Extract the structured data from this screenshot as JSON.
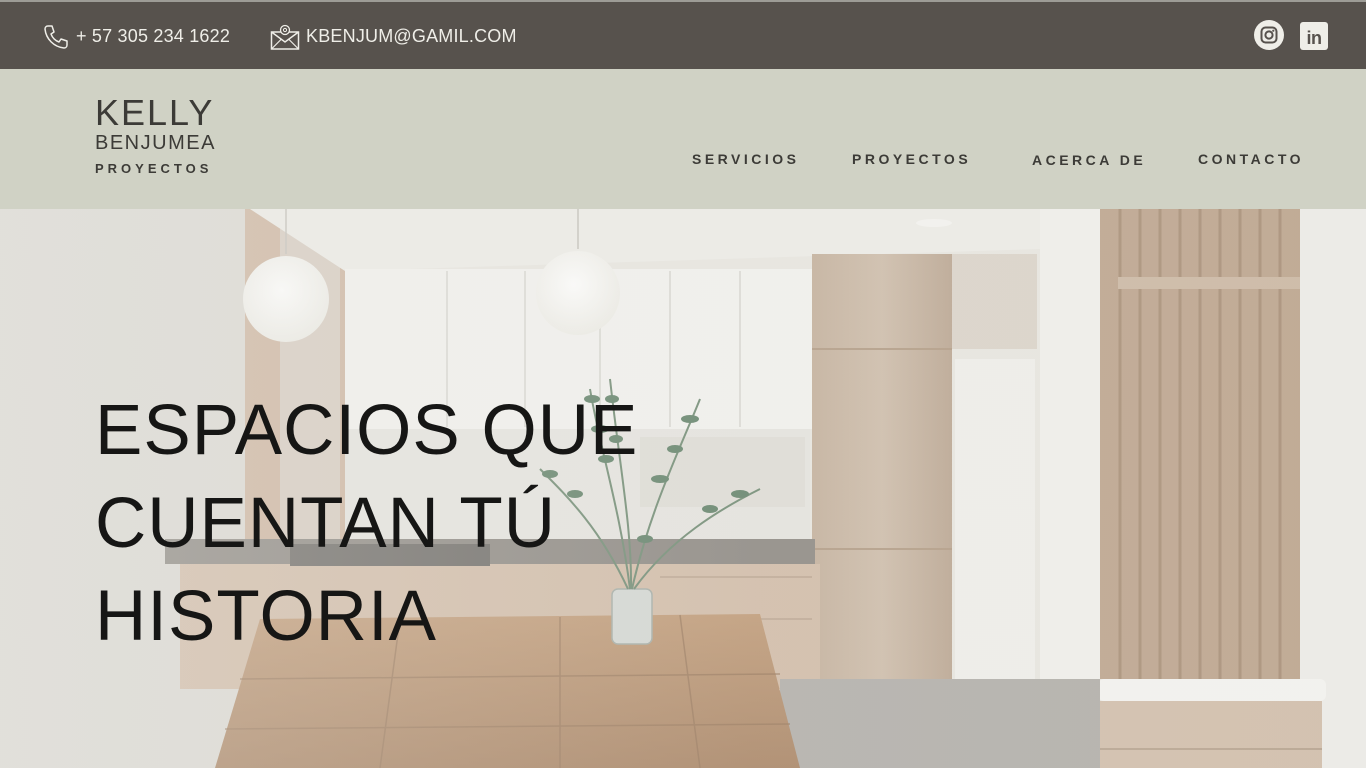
{
  "topbar": {
    "phone": "+ 57 305 234 1622",
    "email": "KBENJUM@GAMIL.COM",
    "social": [
      {
        "name": "instagram-icon"
      },
      {
        "name": "linkedin-icon",
        "glyph": "in"
      }
    ]
  },
  "logo": {
    "line1": "KELLY",
    "line2": "BENJUMEA",
    "line3": "PROYECTOS"
  },
  "nav": {
    "servicios": "SERVICIOS",
    "proyectos": "PROYECTOS",
    "acerca": "ACERCA DE",
    "contacto": "CONTACTO"
  },
  "hero": {
    "line1": "ESPACIOS QUE",
    "line2": "CUENTAN TÚ",
    "line3": "HISTORIA"
  },
  "colors": {
    "topbar_bg": "#57524d",
    "header_bg": "#d0d2c5",
    "text_dark": "#3c3b37",
    "topbar_text": "#efeee8"
  }
}
